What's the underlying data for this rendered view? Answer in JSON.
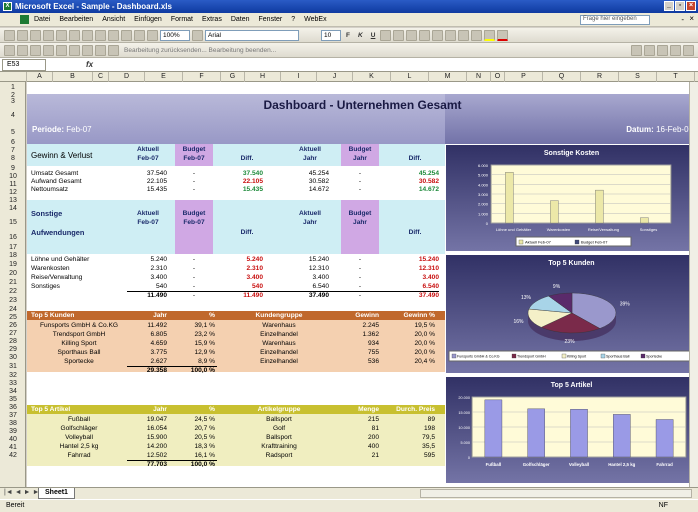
{
  "window": {
    "title": "Microsoft Excel - Sample - Dashboard.xls",
    "minimize": "_",
    "restore": "▫",
    "close": "×",
    "doc_min": "-",
    "doc_close": "×"
  },
  "menu": {
    "items": [
      "Datei",
      "Bearbeiten",
      "Ansicht",
      "Einfügen",
      "Format",
      "Extras",
      "Daten",
      "Fenster",
      "?",
      "WebEx"
    ],
    "help_placeholder": "Frage hier eingeben"
  },
  "toolbar1": {
    "zoom": "100%",
    "font": "Arial",
    "size": "10"
  },
  "toolbar2": {
    "review": "Bearbeitung zurücksenden... Bearbeitung beenden..."
  },
  "formula": {
    "namebox": "E53",
    "fx": "fx",
    "content": ""
  },
  "columns": [
    "A",
    "B",
    "C",
    "D",
    "E",
    "F",
    "G",
    "H",
    "I",
    "J",
    "K",
    "L",
    "M",
    "N",
    "O",
    "P",
    "Q",
    "R",
    "S",
    "T",
    "U",
    "V"
  ],
  "rows": [
    "1",
    "2",
    "3",
    "4",
    "5",
    "6",
    "7",
    "8",
    "9",
    "10",
    "11",
    "12",
    "13",
    "14",
    "15",
    "16",
    "17",
    "18",
    "19",
    "20",
    "21",
    "22",
    "23",
    "24",
    "25",
    "26",
    "27",
    "28",
    "29",
    "30",
    "31",
    "32",
    "33",
    "34",
    "35",
    "36",
    "37",
    "38",
    "39",
    "40",
    "41",
    "42"
  ],
  "dashboard": {
    "title": "Dashboard  - Unternehmen Gesamt",
    "periode_label": "Periode:",
    "periode_value": "Feb-07",
    "datum_label": "Datum:",
    "datum_value": "16-Feb-07"
  },
  "gv": {
    "title": "Gewinn & Verlust",
    "h1": [
      "Aktuell",
      "Feb-07"
    ],
    "h2": [
      "Budget",
      "Feb-07"
    ],
    "h3": "Diff.",
    "h4": [
      "Aktuell",
      "Jahr"
    ],
    "h5": [
      "Budget",
      "Jahr"
    ],
    "h6": "Diff.",
    "rows": [
      {
        "label": "Umsatz Gesamt",
        "a": "37.540",
        "b": "-",
        "d": "37.540",
        "aj": "45.254",
        "bj": "-",
        "dj": "45.254"
      },
      {
        "label": "Aufwand Gesamt",
        "a": "22.105",
        "b": "-",
        "d": "22.105",
        "aj": "30.582",
        "bj": "-",
        "dj": "30.582"
      },
      {
        "label": "Nettoumsatz",
        "a": "15.435",
        "b": "-",
        "d": "15.435",
        "aj": "14.672",
        "bj": "-",
        "dj": "14.672"
      }
    ]
  },
  "aufw": {
    "title1": "Sonstige",
    "title2": "Aufwendungen",
    "h1": [
      "Aktuell",
      "Feb-07"
    ],
    "h2": [
      "Budget",
      "Feb-07"
    ],
    "h3": "Diff.",
    "h4": [
      "Aktuell",
      "Jahr"
    ],
    "h5": [
      "Budget",
      "Jahr"
    ],
    "h6": "Diff.",
    "rows": [
      {
        "label": "Löhne und Gehälter",
        "a": "5.240",
        "b": "-",
        "d": "5.240",
        "aj": "15.240",
        "bj": "-",
        "dj": "15.240"
      },
      {
        "label": "Warenkosten",
        "a": "2.310",
        "b": "-",
        "d": "2.310",
        "aj": "12.310",
        "bj": "-",
        "dj": "12.310"
      },
      {
        "label": "Reise/Verwaltung",
        "a": "3.400",
        "b": "-",
        "d": "3.400",
        "aj": "3.400",
        "bj": "-",
        "dj": "3.400"
      },
      {
        "label": "Sonstiges",
        "a": "540",
        "b": "-",
        "d": "540",
        "aj": "6.540",
        "bj": "-",
        "dj": "6.540"
      }
    ],
    "total": {
      "a": "11.490",
      "b": "-",
      "d": "11.490",
      "aj": "37.490",
      "bj": "-",
      "dj": "37.490"
    }
  },
  "kunden": {
    "title": "Top 5 Kunden",
    "h_jahr": "Jahr",
    "h_pct": "%",
    "h_gruppe": "Kundengruppe",
    "h_gewinn": "Gewinn",
    "h_gewinnpct": "Gewinn %",
    "rows": [
      {
        "name": "Funsports GmbH & Co.KG",
        "jahr": "11.492",
        "pct": "39,1 %",
        "gruppe": "Warenhaus",
        "gewinn": "2.245",
        "gpct": "19,5 %"
      },
      {
        "name": "Trendsport GmbH",
        "jahr": "6.805",
        "pct": "23,2 %",
        "gruppe": "Einzelhandel",
        "gewinn": "1.362",
        "gpct": "20,0 %"
      },
      {
        "name": "Killing Sport",
        "jahr": "4.659",
        "pct": "15,9 %",
        "gruppe": "Warenhaus",
        "gewinn": "934",
        "gpct": "20,0 %"
      },
      {
        "name": "Sporthaus Ball",
        "jahr": "3.775",
        "pct": "12,9 %",
        "gruppe": "Einzelhandel",
        "gewinn": "755",
        "gpct": "20,0 %"
      },
      {
        "name": "Sportecke",
        "jahr": "2.627",
        "pct": "8,9 %",
        "gruppe": "Einzelhandel",
        "gewinn": "536",
        "gpct": "20,4 %"
      }
    ],
    "total": {
      "jahr": "29.358",
      "pct": "100,0 %"
    }
  },
  "artikel": {
    "title": "Top 5 Artikel",
    "h_jahr": "Jahr",
    "h_pct": "%",
    "h_gruppe": "Artikelgruppe",
    "h_menge": "Menge",
    "h_preis": "Durch. Preis",
    "rows": [
      {
        "name": "Fußball",
        "jahr": "19.047",
        "pct": "24,5 %",
        "gruppe": "Ballsport",
        "menge": "215",
        "preis": "89"
      },
      {
        "name": "Golfschläger",
        "jahr": "16.054",
        "pct": "20,7 %",
        "gruppe": "Golf",
        "menge": "81",
        "preis": "198"
      },
      {
        "name": "Volleyball",
        "jahr": "15.900",
        "pct": "20,5 %",
        "gruppe": "Ballsport",
        "menge": "200",
        "preis": "79,5"
      },
      {
        "name": "Hantel 2,5 kg",
        "jahr": "14.200",
        "pct": "18,3 %",
        "gruppe": "Krafttraining",
        "menge": "400",
        "preis": "35,5"
      },
      {
        "name": "Fahrrad",
        "jahr": "12.502",
        "pct": "16,1 %",
        "gruppe": "Radsport",
        "menge": "21",
        "preis": "595"
      }
    ],
    "total": {
      "jahr": "77.703",
      "pct": "100,0 %"
    }
  },
  "tabs": {
    "nav": "|◄ ◄ ► ►|",
    "sheet": "Sheet1"
  },
  "status": {
    "left": "Bereit",
    "right": "NF"
  },
  "chart_data": [
    {
      "type": "bar",
      "title": "Sonstige Kosten",
      "categories": [
        "Löhne und Gehälter",
        "Warenkosten",
        "Reise/Verwaltung",
        "Sonstiges"
      ],
      "series": [
        {
          "name": "Aktuell Feb-07",
          "values": [
            5240,
            2310,
            3400,
            540
          ],
          "color": "#ece8a8"
        },
        {
          "name": "Budget Feb-07",
          "values": [
            0,
            0,
            0,
            0
          ],
          "color": "#404a7a"
        }
      ],
      "yticks": [
        "6.000",
        "5.000",
        "4.000",
        "3.000",
        "2.000",
        "1.000",
        "0"
      ],
      "ylim": [
        0,
        6000
      ],
      "legend": "bottom"
    },
    {
      "type": "pie",
      "title": "Top 5 Kunden",
      "categories": [
        "Funsports GmbH & Co.KG",
        "Trendsport GmbH",
        "Killing Sport",
        "Sporthaus Ball",
        "Sportecke"
      ],
      "values": [
        39.1,
        23.2,
        15.9,
        12.9,
        8.9
      ],
      "labels": [
        "39%",
        "23%",
        "16%",
        "13%",
        "9%"
      ],
      "colors": [
        "#9a98cc",
        "#7a2a4a",
        "#f4f0c8",
        "#a8d4e8",
        "#5a2a6a"
      ],
      "legend": "bottom"
    },
    {
      "type": "bar",
      "title": "Top 5 Artikel",
      "categories": [
        "Fußball",
        "Golfschläger",
        "Volleyball",
        "Hantel 2,5 kg",
        "Fahrrad"
      ],
      "values": [
        19047,
        16054,
        15900,
        14200,
        12502
      ],
      "yticks": [
        "20.000",
        "15.000",
        "10.000",
        "5.000",
        "0"
      ],
      "ylim": [
        0,
        20000
      ],
      "color": "#9a9ae6"
    }
  ]
}
